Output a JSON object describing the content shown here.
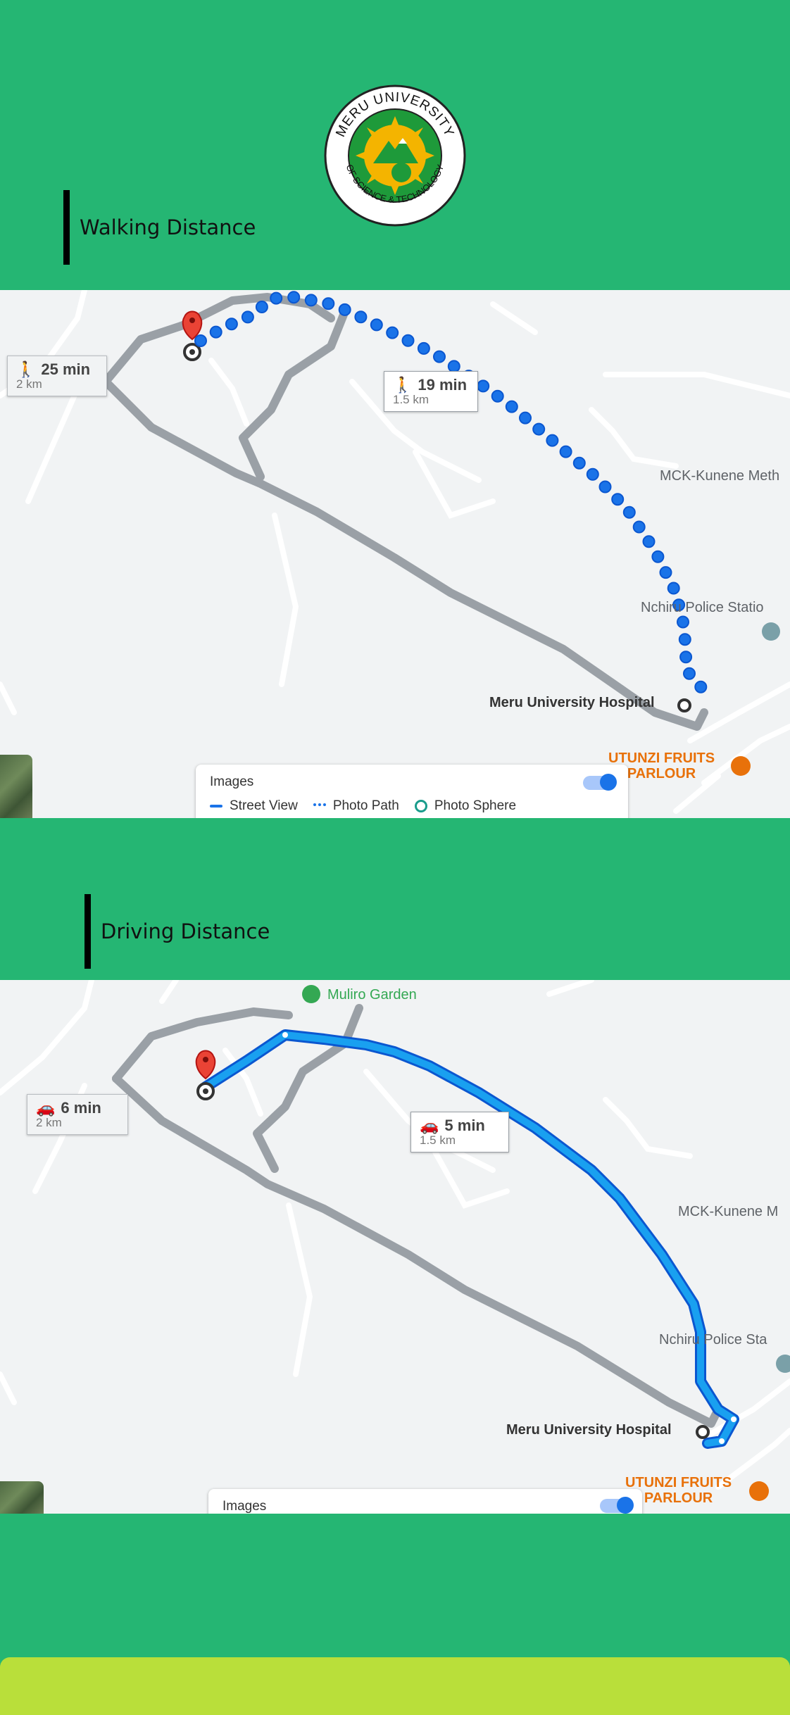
{
  "logo": {
    "text_top": "MERU UNIVERSITY",
    "text_bottom": "OF SCIENCE & TECHNOLOGY"
  },
  "walking": {
    "heading": "Walking Distance",
    "route_alt": {
      "time": "25 min",
      "distance": "2 km",
      "icon": "walk-icon"
    },
    "route_main": {
      "time": "19 min",
      "distance": "1.5 km",
      "icon": "walk-icon"
    },
    "places": {
      "mck": "MCK-Kunene Meth",
      "police": "Nchiru Police Statio",
      "hospital": "Meru University Hospital",
      "utunzi_1": "UTUNZI FRUITS",
      "utunzi_2": "PARLOUR"
    },
    "layers": {
      "title": "Images",
      "street_view": "Street View",
      "photo_path": "Photo Path",
      "photo_sphere": "Photo Sphere"
    }
  },
  "driving": {
    "heading": "Driving Distance",
    "route_alt": {
      "time": "6 min",
      "distance": "2 km",
      "icon": "car-icon"
    },
    "route_main": {
      "time": "5 min",
      "distance": "1.5 km",
      "icon": "car-icon"
    },
    "places": {
      "muliro": "Muliro Garden",
      "mck": "MCK-Kunene M",
      "police": "Nchiru Police Sta",
      "hospital": "Meru University Hospital",
      "utunzi_1": "UTUNZI FRUITS",
      "utunzi_2": "PARLOUR"
    },
    "layers": {
      "title": "Images"
    }
  },
  "colors": {
    "green": "#25b673",
    "lime": "#b9df3a",
    "route_blue": "#1a73e8",
    "route_gray": "#9aa0a6",
    "pin_red": "#ea4335"
  }
}
